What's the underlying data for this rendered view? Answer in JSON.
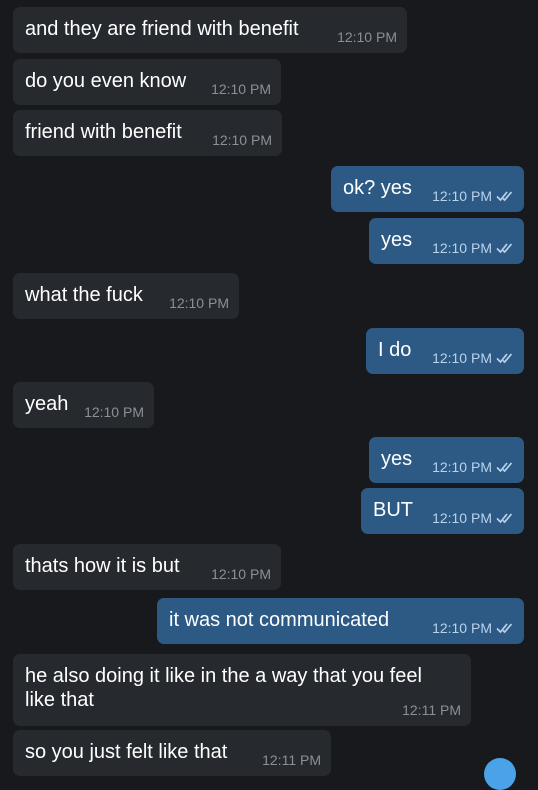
{
  "chat": {
    "messages": [
      {
        "direction": "in",
        "text": "and they are friend with benefit",
        "time": "12:10 PM"
      },
      {
        "direction": "in",
        "text": "do you even know",
        "time": "12:10 PM"
      },
      {
        "direction": "in",
        "text": "friend with benefit",
        "time": "12:10 PM"
      },
      {
        "direction": "out",
        "text": "ok? yes",
        "time": "12:10 PM",
        "status": "read-double-check"
      },
      {
        "direction": "out",
        "text": "yes",
        "time": "12:10 PM",
        "status": "read-double-check"
      },
      {
        "direction": "in",
        "text": "what the fuck",
        "time": "12:10 PM"
      },
      {
        "direction": "out",
        "text": "I do",
        "time": "12:10 PM",
        "status": "read-double-check"
      },
      {
        "direction": "in",
        "text": "yeah",
        "time": "12:10 PM"
      },
      {
        "direction": "out",
        "text": "yes",
        "time": "12:10 PM",
        "status": "read-double-check"
      },
      {
        "direction": "out",
        "text": "BUT",
        "time": "12:10 PM",
        "status": "read-double-check"
      },
      {
        "direction": "in",
        "text": "thats how it is but",
        "time": "12:10 PM"
      },
      {
        "direction": "out",
        "text": "it was not communicated",
        "time": "12:10 PM",
        "status": "read-double-check"
      },
      {
        "direction": "in",
        "text": "he also doing it like in the a way that you feel like that",
        "time": "12:11 PM"
      },
      {
        "direction": "in",
        "text": "so you just felt like that",
        "time": "12:11 PM"
      }
    ]
  },
  "colors": {
    "background": "#17191c",
    "incoming_bubble": "#262a2f",
    "outgoing_bubble": "#2c5a85",
    "read_tick": "#b9d3ec",
    "scroll_button": "#4aa3e8"
  },
  "icons": {
    "read_receipt": "double-check-icon",
    "scroll_down": "scroll-down-button"
  }
}
